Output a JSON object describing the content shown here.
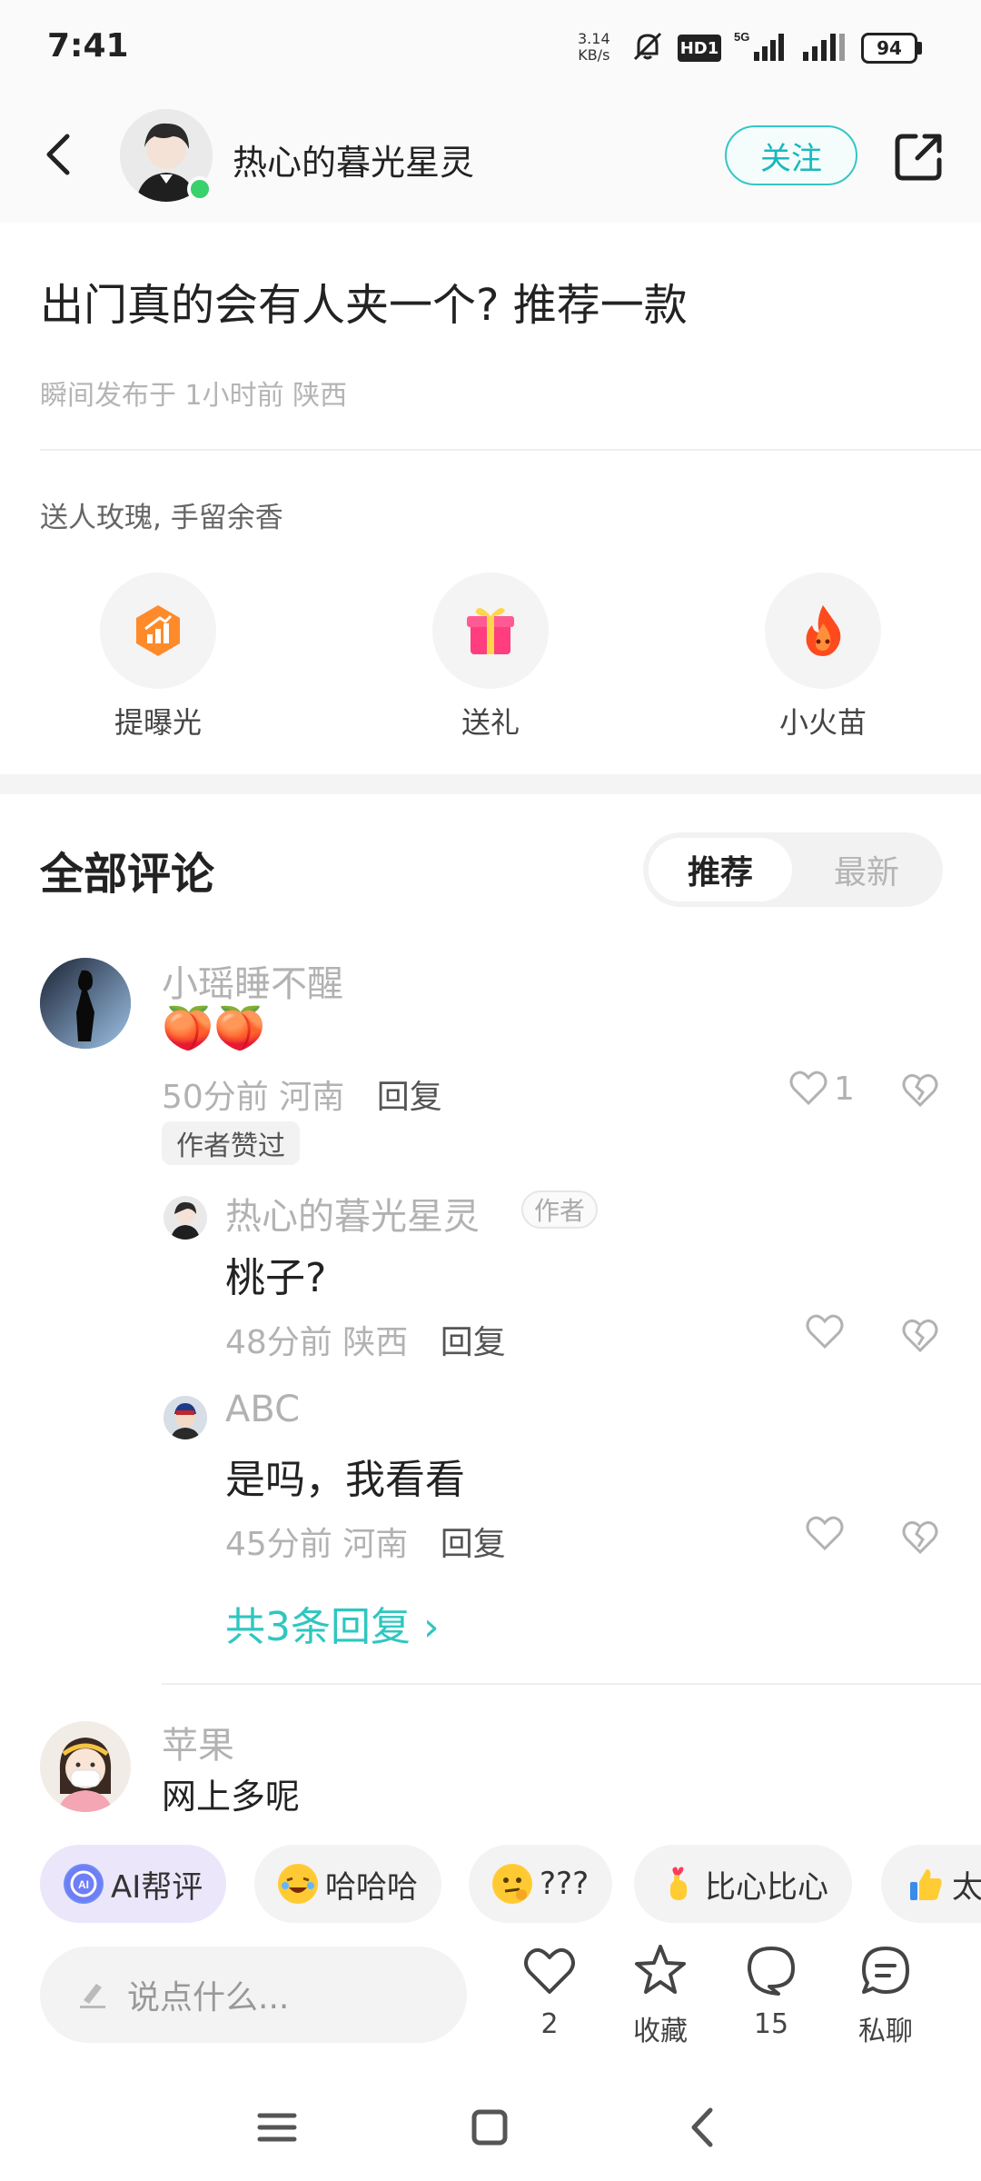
{
  "status_bar": {
    "time": "7:41",
    "net_speed_value": "3.14",
    "net_speed_unit": "KB/s",
    "hd_label": "HD1",
    "network_label": "5G",
    "battery": "94"
  },
  "header": {
    "author_name": "热心的暮光星灵",
    "follow_label": "关注"
  },
  "post": {
    "title": "出门真的会有人夹一个? 推荐一款",
    "meta": "瞬间发布于 1小时前 陕西",
    "gift_caption": "送人玫瑰, 手留余香",
    "actions": [
      {
        "label": "提曝光",
        "icon": "exposure-boost-icon"
      },
      {
        "label": "送礼",
        "icon": "gift-icon"
      },
      {
        "label": "小火苗",
        "icon": "flame-icon"
      }
    ]
  },
  "comments_section": {
    "title": "全部评论",
    "sort_options": [
      "推荐",
      "最新"
    ],
    "selected_sort": "推荐"
  },
  "comments": [
    {
      "name": "小瑶睡不醒",
      "text": "🍑🍑",
      "time": "50分前",
      "location": "河南",
      "reply_label": "回复",
      "likes": "1",
      "badge": "作者赞过",
      "replies": [
        {
          "name": "热心的暮光星灵",
          "tag": "作者",
          "text": "桃子?",
          "time": "48分前",
          "location": "陕西",
          "reply_label": "回复"
        },
        {
          "name": "ABC",
          "text": "是吗，我看看",
          "time": "45分前",
          "location": "河南",
          "reply_label": "回复"
        }
      ],
      "more_replies": "共3条回复 ›"
    },
    {
      "name": "苹果",
      "text": "网上多呢"
    }
  ],
  "quick_replies": [
    {
      "label": "AI帮评",
      "icon": "ai-icon"
    },
    {
      "label": "哈哈哈",
      "icon": "laugh-emoji-icon"
    },
    {
      "label": "???",
      "icon": "thinking-emoji-icon"
    },
    {
      "label": "比心比心",
      "icon": "finger-heart-emoji-icon"
    },
    {
      "label": "太",
      "icon": "thumbs-up-emoji-icon"
    }
  ],
  "bottom_bar": {
    "input_placeholder": "说点什么...",
    "like_count": "2",
    "favorite_label": "收藏",
    "comment_count": "15",
    "chat_label": "私聊"
  },
  "colors": {
    "accent": "#2ec7c0",
    "online": "#39d16b"
  }
}
